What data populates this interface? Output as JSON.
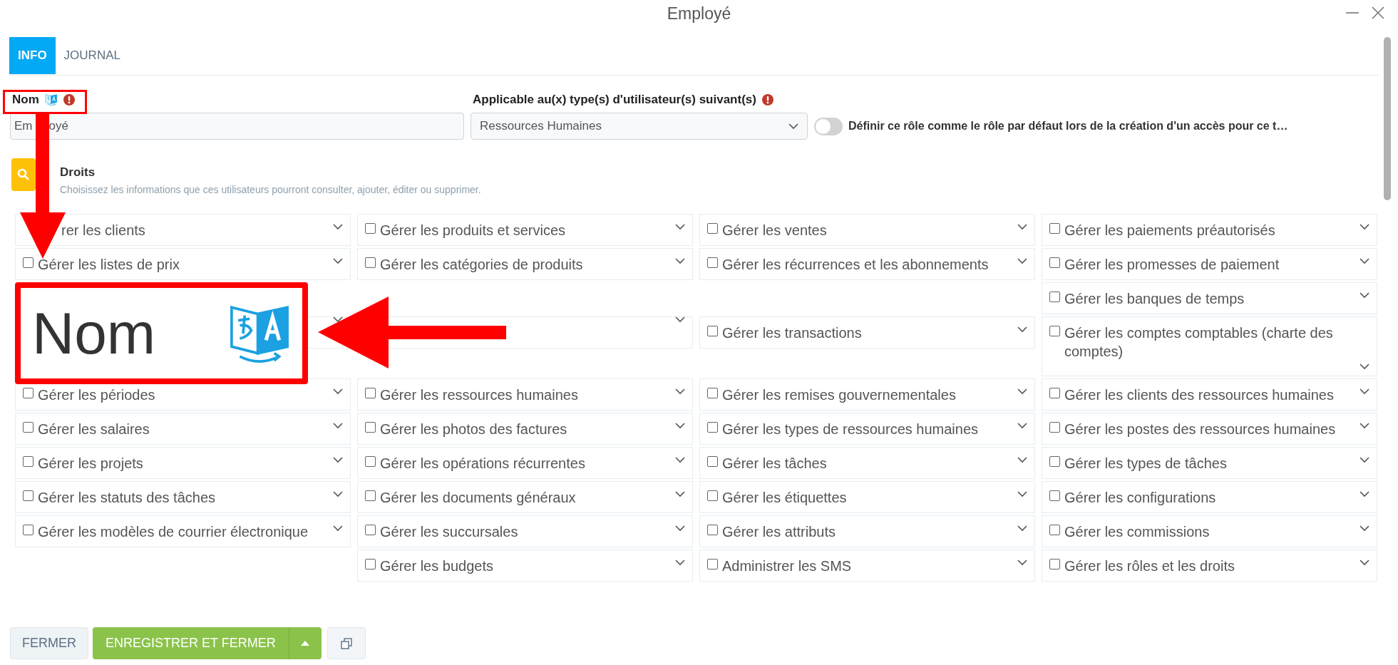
{
  "window": {
    "title": "Employé"
  },
  "tabs": [
    {
      "label": "INFO",
      "selected": true
    },
    {
      "label": "JOURNAL",
      "selected": false
    }
  ],
  "name_field": {
    "label": "Nom",
    "value_parts": [
      "Em",
      "oyé"
    ],
    "required": true
  },
  "user_type_field": {
    "label": "Applicable au(x) type(s) d'utilisateur(s) suivant(s)",
    "value": "Ressources Humaines",
    "required": true
  },
  "default_role_toggle": {
    "label": "Définir ce rôle comme le rôle par défaut lors de la création d'un accès pour ce t…",
    "on": false
  },
  "rights": {
    "title": "Droits",
    "description": "Choisissez les informations que ces utilisateurs pourront consulter, ajouter, éditer ou supprimer."
  },
  "permission_rows": [
    {
      "cells": [
        [
          {
            "kind": "partly_covered",
            "label": "rer les clients"
          }
        ],
        [
          {
            "kind": "permission",
            "label": "Gérer les produits et services",
            "checked": false
          }
        ],
        [
          {
            "kind": "permission",
            "label": "Gérer les ventes",
            "checked": false
          }
        ],
        [
          {
            "kind": "permission",
            "label": "Gérer les paiements préautorisés",
            "checked": false
          }
        ]
      ]
    },
    {
      "cells": [
        [
          {
            "kind": "permission",
            "label": "Gérer les listes de prix",
            "checked": false
          }
        ],
        [
          {
            "kind": "permission",
            "label": "Gérer les catégories de produits",
            "checked": false
          }
        ],
        [
          {
            "kind": "permission",
            "label": "Gérer les récurrences et les abonnements",
            "checked": false
          }
        ],
        [
          {
            "kind": "permission",
            "label": "Gérer les promesses de paiement",
            "checked": false
          },
          {
            "kind": "permission",
            "label": "Gérer les banques de temps",
            "checked": false
          }
        ]
      ]
    },
    {
      "cells": [
        [
          {
            "kind": "covered"
          }
        ],
        [
          {
            "kind": "covered"
          }
        ],
        [
          {
            "kind": "permission",
            "label": "Gérer les transactions",
            "checked": false
          }
        ],
        [
          {
            "kind": "permission",
            "label": "Gérer les comptes comptables (charte des comptes)",
            "checked": false
          }
        ]
      ]
    },
    {
      "cells": [
        [
          {
            "kind": "permission",
            "label": "Gérer les périodes",
            "checked": false
          }
        ],
        [
          {
            "kind": "permission",
            "label": "Gérer les ressources humaines",
            "checked": false
          }
        ],
        [
          {
            "kind": "permission",
            "label": "Gérer les remises gouvernementales",
            "checked": false
          }
        ],
        [
          {
            "kind": "permission",
            "label": "Gérer les clients des ressources humaines",
            "checked": false
          }
        ]
      ]
    },
    {
      "cells": [
        [
          {
            "kind": "permission",
            "label": "Gérer les salaires",
            "checked": false
          }
        ],
        [
          {
            "kind": "permission",
            "label": "Gérer les photos des factures",
            "checked": false
          }
        ],
        [
          {
            "kind": "permission",
            "label": "Gérer les types de ressources humaines",
            "checked": false
          }
        ],
        [
          {
            "kind": "permission",
            "label": "Gérer les postes des ressources humaines",
            "checked": false
          }
        ]
      ]
    },
    {
      "cells": [
        [
          {
            "kind": "permission",
            "label": "Gérer les projets",
            "checked": false
          }
        ],
        [
          {
            "kind": "permission",
            "label": "Gérer les opérations récurrentes",
            "checked": false
          }
        ],
        [
          {
            "kind": "permission",
            "label": "Gérer les tâches",
            "checked": false
          }
        ],
        [
          {
            "kind": "permission",
            "label": "Gérer les types de tâches",
            "checked": false
          }
        ]
      ]
    },
    {
      "cells": [
        [
          {
            "kind": "permission",
            "label": "Gérer les statuts des tâches",
            "checked": false
          }
        ],
        [
          {
            "kind": "permission",
            "label": "Gérer les documents généraux",
            "checked": false
          }
        ],
        [
          {
            "kind": "permission",
            "label": "Gérer les étiquettes",
            "checked": false
          }
        ],
        [
          {
            "kind": "permission",
            "label": "Gérer les configurations",
            "checked": false
          }
        ]
      ]
    },
    {
      "cells": [
        [
          {
            "kind": "permission",
            "label": "Gérer les modèles de courrier électronique",
            "checked": false
          }
        ],
        [
          {
            "kind": "permission",
            "label": "Gérer les succursales",
            "checked": false
          },
          {
            "kind": "permission",
            "label": "Gérer les budgets",
            "checked": false
          }
        ],
        [
          {
            "kind": "permission",
            "label": "Gérer les attributs",
            "checked": false
          },
          {
            "kind": "permission",
            "label": "Administrer les SMS",
            "checked": false
          }
        ],
        [
          {
            "kind": "permission",
            "label": "Gérer les commissions",
            "checked": false
          },
          {
            "kind": "permission",
            "label": "Gérer les rôles et les droits",
            "checked": false
          }
        ]
      ]
    }
  ],
  "buttons": [
    {
      "kind": "close",
      "label": "FERMER"
    },
    {
      "kind": "save",
      "label": "ENREGISTRER ET FERMER"
    },
    {
      "kind": "save_menu"
    },
    {
      "kind": "copy"
    }
  ],
  "annotations": [
    {
      "kind": "highlight_box"
    },
    {
      "kind": "arrow_down"
    },
    {
      "kind": "callout",
      "label": "Nom"
    },
    {
      "kind": "arrow_left"
    }
  ]
}
